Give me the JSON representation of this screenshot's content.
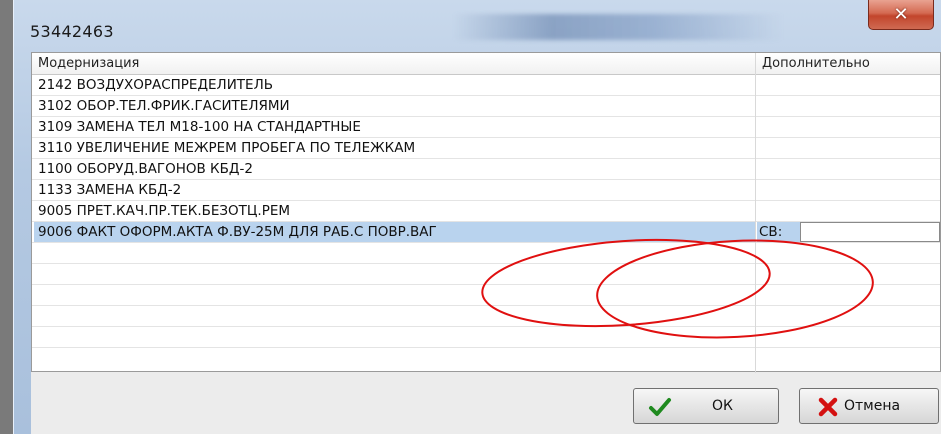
{
  "window": {
    "title": "53442463",
    "close_glyph": "✕"
  },
  "table": {
    "columns": [
      "Модернизация",
      "Дополнительно"
    ],
    "rows": [
      {
        "text": "2142 ВОЗДУХОРАСПРЕДЕЛИТЕЛЬ",
        "extra": ""
      },
      {
        "text": "3102 ОБОР.ТЕЛ.ФРИК.ГАСИТЕЛЯМИ",
        "extra": ""
      },
      {
        "text": "3109 ЗАМЕНА ТЕЛ М18-100 НА СТАНДАРТНЫЕ",
        "extra": ""
      },
      {
        "text": "3110 УВЕЛИЧЕНИЕ МЕЖРЕМ ПРОБЕГА ПО ТЕЛЕЖКАМ",
        "extra": ""
      },
      {
        "text": "1100 ОБОРУД.ВАГОНОВ КБД-2",
        "extra": ""
      },
      {
        "text": "1133 ЗАМЕНА КБД-2",
        "extra": ""
      },
      {
        "text": "9005 ПРЕТ.КАЧ.ПР.ТЕК.БЕЗОТЦ.РЕМ",
        "extra": ""
      },
      {
        "text": "9006 ФАКТ ОФОРМ.АКТА Ф.ВУ-25М ДЛЯ РАБ.С ПОВР.ВАГ",
        "extra": "СВ:",
        "selected": true,
        "input_value": ""
      }
    ]
  },
  "buttons": {
    "ok_label": "ОК",
    "cancel_label": "Отмена"
  },
  "icons": {
    "ok": "check-icon",
    "cancel": "x-icon",
    "close": "close-icon"
  },
  "colors": {
    "selection": "#b9d3ee",
    "annotation_ellipse": "#e01010",
    "close_button": "#c8462e",
    "check_green": "#1f8a1f",
    "cancel_red": "#d41111"
  }
}
